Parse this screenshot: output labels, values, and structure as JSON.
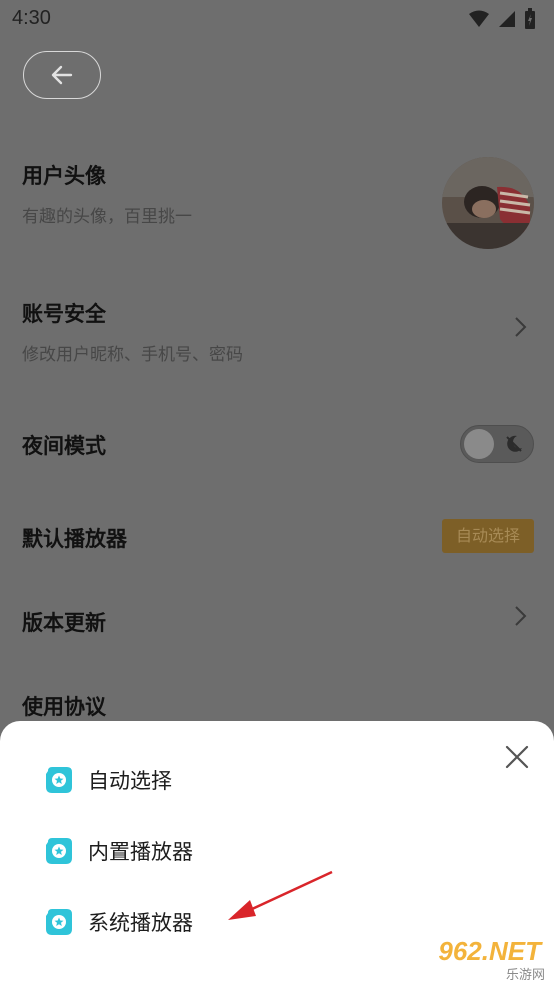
{
  "status_bar": {
    "time": "4:30"
  },
  "header": {
    "back_icon": "arrow-left-icon"
  },
  "settings": {
    "avatar": {
      "title": "用户头像",
      "subtitle": "有趣的头像，百里挑一"
    },
    "account": {
      "title": "账号安全",
      "subtitle": "修改用户昵称、手机号、密码"
    },
    "night_mode": {
      "title": "夜间模式",
      "enabled": false
    },
    "default_player": {
      "title": "默认播放器",
      "value": "自动选择"
    },
    "version": {
      "title": "版本更新"
    },
    "agreement": {
      "title": "使用协议"
    }
  },
  "sheet": {
    "options": [
      "自动选择",
      "内置播放器",
      "系统播放器"
    ],
    "close_icon": "close-icon"
  },
  "watermark": {
    "brand": "962.NET",
    "subtitle": "乐游网"
  },
  "colors": {
    "accent": "#2fc4d9",
    "arrow": "#d9252a",
    "badge": "#7d5f27"
  }
}
